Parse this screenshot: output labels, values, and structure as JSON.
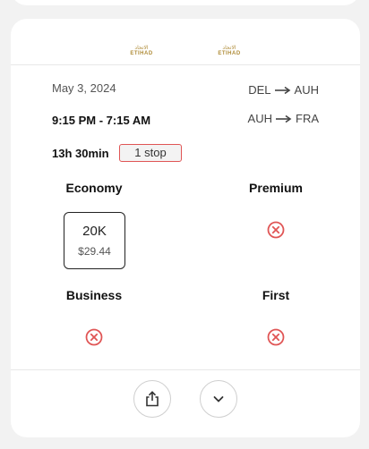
{
  "airline": {
    "logo_arabic": "الاتحاد",
    "logo_text": "ETIHAD"
  },
  "flight": {
    "date": "May 3, 2024",
    "times": "9:15 PM - 7:15 AM",
    "duration": "13h 30min",
    "stops": "1 stop",
    "segments": [
      {
        "from": "DEL",
        "to": "AUH"
      },
      {
        "from": "AUH",
        "to": "FRA"
      }
    ]
  },
  "cabins": {
    "economy": {
      "label": "Economy",
      "points": "20K",
      "price": "$29.44",
      "available": true
    },
    "premium": {
      "label": "Premium",
      "available": false
    },
    "business": {
      "label": "Business",
      "available": false
    },
    "first": {
      "label": "First",
      "available": false
    }
  },
  "icons": {
    "unavailable": "x-circle-icon",
    "share": "share-icon",
    "expand": "chevron-down-icon",
    "arrow": "arrow-right-icon"
  },
  "colors": {
    "unavailable": "#e05555",
    "stop_border": "#e05555",
    "logo_gold": "#b08d3a"
  }
}
